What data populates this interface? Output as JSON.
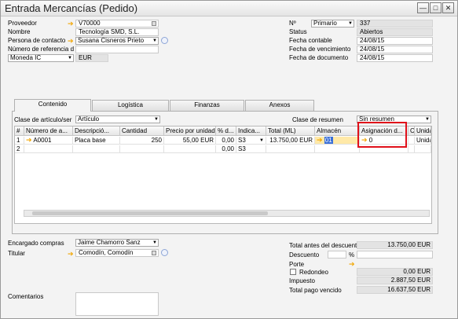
{
  "window": {
    "title": "Entrada Mercancías (Pedido)"
  },
  "header_left": {
    "proveedor_label": "Proveedor",
    "proveedor_value": "V70000",
    "nombre_label": "Nombre",
    "nombre_value": "Tecnología SMD, S.L.",
    "contacto_label": "Persona de contacto",
    "contacto_value": "Susana Cisneros Prieto",
    "referencia_label": "Número de referencia d",
    "referencia_value": "",
    "moneda_select": "Moneda IC",
    "moneda_value": "EUR"
  },
  "header_right": {
    "numero_label": "Nº",
    "numero_series": "Primario",
    "numero_value": "337",
    "status_label": "Status",
    "status_value": "Abiertos",
    "fecha_contable_label": "Fecha contable",
    "fecha_contable_value": "24/08/15",
    "fecha_vencimiento_label": "Fecha de vencimiento",
    "fecha_vencimiento_value": "24/08/15",
    "fecha_documento_label": "Fecha de documento",
    "fecha_documento_value": "24/08/15"
  },
  "tabs": [
    "Contenido",
    "Logística",
    "Finanzas",
    "Anexos"
  ],
  "contenido": {
    "clase_articulo_label": "Clase de artículo/ser",
    "clase_articulo_value": "Artículo",
    "clase_resumen_label": "Clase de resumen",
    "clase_resumen_value": "Sin resumen"
  },
  "table": {
    "columns": [
      "#",
      "Número de a...",
      "Descripció...",
      "Cantidad",
      "Precio por unidad",
      "% d...",
      "Indica...",
      "Total (ML)",
      "Almacén",
      "Asignación d...",
      "C",
      "Unida"
    ],
    "rows": [
      {
        "num": "1",
        "articulo": "A0001",
        "descripcion": "Placa base",
        "cantidad": "250",
        "precio": "55,00 EUR",
        "desc": "0,00",
        "indicador": "S3",
        "total": "13.750,00 EUR",
        "almacen": "01",
        "asignacion": "0",
        "unidad": "Unida"
      },
      {
        "num": "2",
        "articulo": "",
        "descripcion": "",
        "cantidad": "",
        "precio": "",
        "desc": "0,00",
        "indicador": "S3",
        "total": "",
        "almacen": "",
        "asignacion": "",
        "unidad": ""
      }
    ]
  },
  "footer_left": {
    "encargado_label": "Encargado compras",
    "encargado_value": "Jaime Chamorro Sanz",
    "titular_label": "Titular",
    "titular_value": "Comodín, Comodín",
    "comentarios_label": "Comentarios"
  },
  "totals": {
    "total_antes_label": "Total antes del descuento",
    "total_antes_value": "13.750,00 EUR",
    "descuento_label": "Descuento",
    "descuento_pct": "%",
    "porte_label": "Porte",
    "redondeo_label": "Redondeo",
    "redondeo_value": "0,00 EUR",
    "impuesto_label": "Impuesto",
    "impuesto_value": "2.887,50 EUR",
    "total_pago_label": "Total pago vencido",
    "total_pago_value": "16.637,50 EUR"
  },
  "colors": {
    "highlight": "#e0101a",
    "link_arrow": "#f2a600",
    "readonly": "#e3e3e3"
  }
}
